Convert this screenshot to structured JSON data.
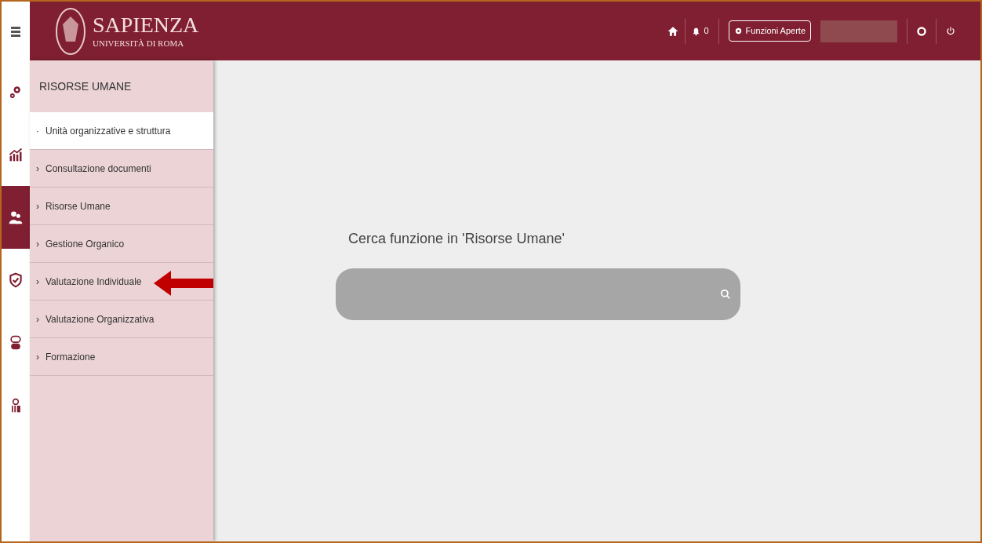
{
  "header": {
    "logo_title": "SAPIENZA",
    "logo_subtitle": "UNIVERSITÀ DI ROMA",
    "notifications": "0",
    "open_functions_button": "Funzioni Aperte"
  },
  "rail": [
    {
      "kind": "gears",
      "selected": false
    },
    {
      "kind": "chart",
      "selected": false
    },
    {
      "kind": "people",
      "selected": true
    },
    {
      "kind": "shield",
      "selected": false
    },
    {
      "kind": "toggles",
      "selected": false
    },
    {
      "kind": "emblem",
      "selected": false
    }
  ],
  "menu": {
    "title": "RISORSE UMANE",
    "items": [
      {
        "marker": "·",
        "label": "Unità organizzative e struttura",
        "selected": true
      },
      {
        "marker": "›",
        "label": "Consultazione documenti",
        "selected": false
      },
      {
        "marker": "›",
        "label": "Risorse Umane",
        "selected": false
      },
      {
        "marker": "›",
        "label": "Gestione Organico",
        "selected": false
      },
      {
        "marker": "›",
        "label": "Valutazione Individuale",
        "selected": false,
        "annotated": true
      },
      {
        "marker": "›",
        "label": "Valutazione Organizzativa",
        "selected": false
      },
      {
        "marker": "›",
        "label": "Formazione",
        "selected": false
      }
    ]
  },
  "search": {
    "label": "Cerca funzione in 'Risorse Umane'"
  }
}
